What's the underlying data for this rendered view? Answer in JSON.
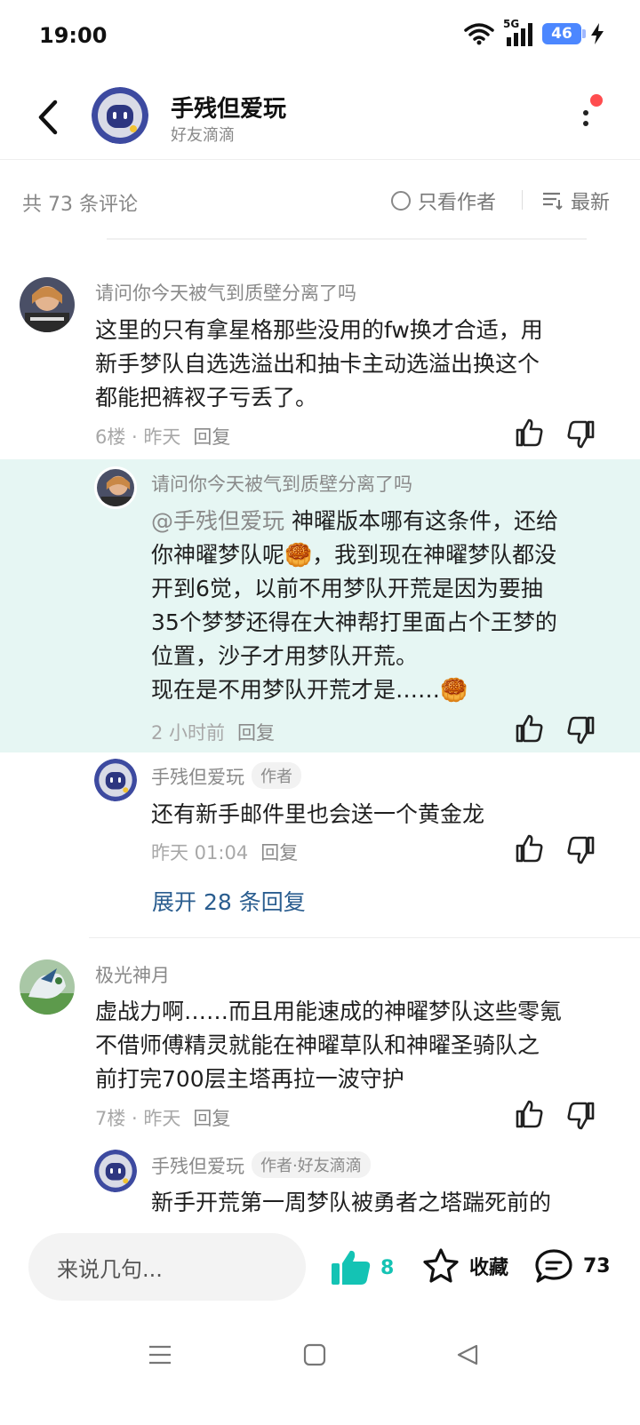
{
  "status": {
    "time": "19:00",
    "network": "5G",
    "battery": "46"
  },
  "header": {
    "title": "手残但爱玩",
    "subtitle": "好友滴滴"
  },
  "filter": {
    "count_text": "共 73 条评论",
    "author_only": "只看作者",
    "sort": "最新"
  },
  "comments": [
    {
      "user": "请问你今天被气到质壁分离了吗",
      "lines": [
        "这里的只有拿星格那些没用的fw换才合适，用",
        "新手梦队自选选溢出和抽卡主动选溢出换这个",
        "都能把裤衩子亏丢了。"
      ],
      "floor": "6楼 · 昨天",
      "reply": "回复"
    },
    {
      "user": "请问你今天被气到质壁分离了吗",
      "mention": "@手残但爱玩",
      "lines": [
        " 神曜版本哪有这条件，还给",
        "你神曜梦队呢🥮，我到现在神曜梦队都没",
        "开到6觉，以前不用梦队开荒是因为要抽",
        "35个梦梦还得在大神帮打里面占个王梦的",
        "位置，沙子才用梦队开荒。",
        "现在是不用梦队开荒才是……🥮"
      ],
      "time": "2 小时前",
      "reply": "回复"
    },
    {
      "user": "手残但爱玩",
      "badge": "作者",
      "lines": [
        "还有新手邮件里也会送一个黄金龙"
      ],
      "time": "昨天 01:04",
      "reply": "回复"
    },
    {
      "user": "极光神月",
      "lines": [
        "虚战力啊……而且用能速成的神曜梦队这些零氪",
        "不借师傅精灵就能在神曜草队和神曜圣骑队之",
        "前打完700层主塔再拉一波守护"
      ],
      "floor": "7楼 · 昨天",
      "reply": "回复"
    },
    {
      "user": "手残但爱玩",
      "badge": "作者·好友滴滴",
      "lines": [
        "新手开荒第一周梦队被勇者之塔踹死前的"
      ]
    }
  ],
  "expand": "展开 28 条回复",
  "bottom": {
    "placeholder": "来说几句...",
    "likes": "8",
    "favorite": "收藏",
    "comments": "73"
  },
  "colors": {
    "accent": "#14c3b4",
    "highlight": "#e6f6f3",
    "link": "#2a5d8f"
  }
}
